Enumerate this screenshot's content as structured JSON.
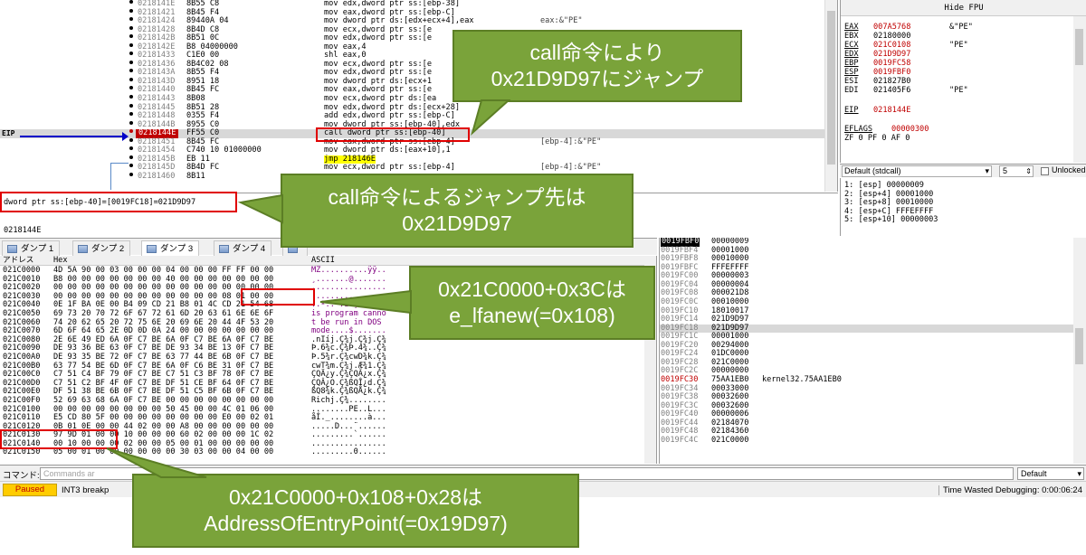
{
  "disasm": {
    "eip_label": "EIP",
    "rows": [
      {
        "addr": "0218141E",
        "bytes": "8B55 C8",
        "instr": "mov edx,dword ptr ss:[ebp-38]",
        "comment": ""
      },
      {
        "addr": "02181421",
        "bytes": "8B45 F4",
        "instr": "mov eax,dword ptr ss:[ebp-C]",
        "comment": ""
      },
      {
        "addr": "02181424",
        "bytes": "89440A 04",
        "instr": "mov dword ptr ds:[edx+ecx+4],eax",
        "comment": "eax:&\"PE\""
      },
      {
        "addr": "02181428",
        "bytes": "8B4D C8",
        "instr": "mov ecx,dword ptr ss:[e",
        "comment": ""
      },
      {
        "addr": "0218142B",
        "bytes": "8B51 0C",
        "instr": "mov edx,dword ptr ss:[e",
        "comment": ""
      },
      {
        "addr": "0218142E",
        "bytes": "B8 04000000",
        "instr": "mov eax,4",
        "comment": ""
      },
      {
        "addr": "02181433",
        "bytes": "C1E0 00",
        "instr": "shl eax,0",
        "comment": ""
      },
      {
        "addr": "02181436",
        "bytes": "8B4C02 08",
        "instr": "mov ecx,dword ptr ss:[e",
        "comment": ""
      },
      {
        "addr": "0218143A",
        "bytes": "8B55 F4",
        "instr": "mov edx,dword ptr ss:[e",
        "comment": ""
      },
      {
        "addr": "0218143D",
        "bytes": "8951 18",
        "instr": "mov dword ptr ds:[ecx+1",
        "comment": ""
      },
      {
        "addr": "02181440",
        "bytes": "8B45 FC",
        "instr": "mov eax,dword ptr ss:[e",
        "comment": ""
      },
      {
        "addr": "02181443",
        "bytes": "8B08",
        "instr": "mov ecx,dword ptr ds:[ea",
        "comment": ""
      },
      {
        "addr": "02181445",
        "bytes": "8B51 28",
        "instr": "mov edx,dword ptr ds:[ecx+28]",
        "comment": ""
      },
      {
        "addr": "02181448",
        "bytes": "0355 F4",
        "instr": "add edx,dword ptr ss:[ebp-C]",
        "comment": ""
      },
      {
        "addr": "0218144B",
        "bytes": "8955 C0",
        "instr": "mov dword ptr ss:[ebp-40],edx",
        "comment": ""
      },
      {
        "addr": "0218144E",
        "bytes": "FF55 C0",
        "instr": "call dword ptr ss:[ebp-40]",
        "comment": ""
      },
      {
        "addr": "02181451",
        "bytes": "8B45 FC",
        "instr": "mov eax,dword ptr ss:[ebp-4]",
        "comment": "[ebp-4]:&\"PE\""
      },
      {
        "addr": "02181454",
        "bytes": "C740 10 01000000",
        "instr": "mov dword ptr ds:[eax+10],1",
        "comment": ""
      },
      {
        "addr": "0218145B",
        "bytes": "EB 11",
        "instr": "jmp 218146E",
        "comment": ""
      },
      {
        "addr": "0218145D",
        "bytes": "8B4D FC",
        "instr": "mov ecx,dword ptr ss:[ebp-4]",
        "comment": "[ebp-4]:&\"PE\""
      },
      {
        "addr": "02181460",
        "bytes": "8B11",
        "instr": "",
        "comment": ""
      }
    ]
  },
  "info": {
    "line": "dword ptr ss:[ebp-40]=[0019FC18]=021D9D97",
    "addr": "0218144E"
  },
  "registers": {
    "header": "Hide FPU",
    "rows": [
      {
        "name": "EAX",
        "value": "007A5768",
        "comment": "&\"PE\"",
        "changed": true
      },
      {
        "name": "EBX",
        "value": "02180000",
        "comment": "",
        "changed": false
      },
      {
        "name": "ECX",
        "value": "021C0108",
        "comment": "\"PE\"",
        "changed": true
      },
      {
        "name": "EDX",
        "value": "021D9D97",
        "comment": "",
        "changed": true
      },
      {
        "name": "EBP",
        "value": "0019FC58",
        "comment": "",
        "changed": true
      },
      {
        "name": "ESP",
        "value": "0019FBF0",
        "comment": "",
        "changed": true
      },
      {
        "name": "ESI",
        "value": "021827B0",
        "comment": "",
        "changed": false
      },
      {
        "name": "EDI",
        "value": "021405F6",
        "comment": "\"PE\"",
        "changed": false
      },
      {
        "name": "EIP",
        "value": "0218144E",
        "comment": "",
        "changed": true
      },
      {
        "name": "EFLAGS",
        "value": "00000300",
        "comment": "",
        "changed": true
      }
    ],
    "flags": "ZF 0  PF 0  AF 0"
  },
  "callstack": {
    "convention": "Default (stdcall)",
    "arg_count": "5",
    "unlocked_label": "Unlocked",
    "args": [
      "1: [esp] 00000009",
      "2: [esp+4] 00001000",
      "3: [esp+8] 00010000",
      "4: [esp+C] FFFEFFFF",
      "5: [esp+10] 00000003"
    ]
  },
  "dump_tabs": [
    "ダンプ 1",
    "ダンプ 2",
    "ダンプ 3",
    "ダンプ 4",
    ""
  ],
  "dump": {
    "col_addr": "アドレス",
    "col_hex": "Hex",
    "col_ascii": "ASCII",
    "rows": [
      {
        "addr": "021C0000",
        "hex": "4D 5A 90 00 03 00 00 00 04 00 00 00 FF FF 00 00",
        "ascii": "MZ..........ÿÿ.."
      },
      {
        "addr": "021C0010",
        "hex": "B8 00 00 00 00 00 00 00 40 00 00 00 00 00 00 00",
        "ascii": "¸.......@......."
      },
      {
        "addr": "021C0020",
        "hex": "00 00 00 00 00 00 00 00 00 00 00 00 00 00 00 00",
        "ascii": "................"
      },
      {
        "addr": "021C0030",
        "hex": "00 00 00 00 00 00 00 00 00 00 00 00 08 01 00 00",
        "ascii": "................"
      },
      {
        "addr": "021C0040",
        "hex": "0E 1F BA 0E 00 B4 09 CD 21 B8 01 4C CD 21 54 68",
        "ascii": "..º..´.Í!¸.LÍ!Th"
      },
      {
        "addr": "021C0050",
        "hex": "69 73 20 70 72 6F 67 72 61 6D 20 63 61 6E 6E 6F",
        "ascii": "is program canno"
      },
      {
        "addr": "021C0060",
        "hex": "74 20 62 65 20 72 75 6E 20 69 6E 20 44 4F 53 20",
        "ascii": "t be run in DOS "
      },
      {
        "addr": "021C0070",
        "hex": "6D 6F 64 65 2E 0D 0D 0A 24 00 00 00 00 00 00 00",
        "ascii": "mode....$......."
      },
      {
        "addr": "021C0080",
        "hex": "2E 6E 49 ED 6A 0F C7 BE 6A 0F C7 BE 6A 0F C7 BE",
        "ascii": ".nIíj.Ç¾j.Ç¾j.Ç¾"
      },
      {
        "addr": "021C0090",
        "hex": "DE 93 36 BE 63 0F C7 BE DE 93 34 BE 13 0F C7 BE",
        "ascii": "Þ.6¾c.Ç¾Þ.4¾..Ç¾"
      },
      {
        "addr": "021C00A0",
        "hex": "DE 93 35 BE 72 0F C7 BE 63 77 44 BE 6B 0F C7 BE",
        "ascii": "Þ.5¾r.Ç¾cwD¾k.Ç¾"
      },
      {
        "addr": "021C00B0",
        "hex": "63 77 54 BE 6D 0F C7 BE 6A 0F C6 BE 31 0F C7 BE",
        "ascii": "cwT¾m.Ç¾j.Æ¾1.Ç¾"
      },
      {
        "addr": "021C00C0",
        "hex": "C7 51 C4 BF 79 0F C7 BE C7 51 C3 BF 78 0F C7 BE",
        "ascii": "ÇQÄ¿y.Ç¾ÇQÃ¿x.Ç¾"
      },
      {
        "addr": "021C00D0",
        "hex": "C7 51 C2 BF 4F 0F C7 BE DF 51 CE BF 64 0F C7 BE",
        "ascii": "ÇQÂ¿O.Ç¾ßQÎ¿d.Ç¾"
      },
      {
        "addr": "021C00E0",
        "hex": "DF 51 38 BE 6B 0F C7 BE DF 51 C5 BF 6B 0F C7 BE",
        "ascii": "ßQ8¾k.Ç¾ßQÅ¿k.Ç¾"
      },
      {
        "addr": "021C00F0",
        "hex": "52 69 63 68 6A 0F C7 BE 00 00 00 00 00 00 00 00",
        "ascii": "Richj.Ç¾........"
      },
      {
        "addr": "021C0100",
        "hex": "00 00 00 00 00 00 00 00 50 45 00 00 4C 01 06 00",
        "ascii": "........PE..L..."
      },
      {
        "addr": "021C0110",
        "hex": "E5 CD 80 5F 00 00 00 00 00 00 00 00 E0 00 02 01",
        "ascii": "åÍ._........à..."
      },
      {
        "addr": "021C0120",
        "hex": "0B 01 0E 00 00 44 02 00 00 A8 00 00 00 00 00 00",
        "ascii": ".....D...¨......"
      },
      {
        "addr": "021C0130",
        "hex": "97 9D 01 00 00 10 00 00 00 60 02 00 00 00 1C 02",
        "ascii": ".........`......"
      },
      {
        "addr": "021C0140",
        "hex": "00 10 00 00 00 02 00 00 05 00 01 00 00 00 00 00",
        "ascii": "................"
      },
      {
        "addr": "021C0150",
        "hex": "05 00 01 00 00 00 00 00 00 30 03 00 00 04 00 00",
        "ascii": ".........0......"
      }
    ]
  },
  "stack": {
    "rows": [
      {
        "addr": "0019FBF0",
        "val": "00000009",
        "comment": ""
      },
      {
        "addr": "0019FBF4",
        "val": "00001000",
        "comment": ""
      },
      {
        "addr": "0019FBF8",
        "val": "00010000",
        "comment": ""
      },
      {
        "addr": "0019FBFC",
        "val": "FFFEFFFF",
        "comment": ""
      },
      {
        "addr": "0019FC00",
        "val": "00000003",
        "comment": ""
      },
      {
        "addr": "0019FC04",
        "val": "00000004",
        "comment": ""
      },
      {
        "addr": "0019FC08",
        "val": "000021D8",
        "comment": ""
      },
      {
        "addr": "0019FC0C",
        "val": "00010000",
        "comment": ""
      },
      {
        "addr": "0019FC10",
        "val": "18010017",
        "comment": ""
      },
      {
        "addr": "0019FC14",
        "val": "021D9D97",
        "comment": ""
      },
      {
        "addr": "0019FC18",
        "val": "021D9D97",
        "comment": ""
      },
      {
        "addr": "0019FC1C",
        "val": "00001000",
        "comment": ""
      },
      {
        "addr": "0019FC20",
        "val": "00294000",
        "comment": ""
      },
      {
        "addr": "0019FC24",
        "val": "01DC0000",
        "comment": ""
      },
      {
        "addr": "0019FC28",
        "val": "021C0000",
        "comment": ""
      },
      {
        "addr": "0019FC2C",
        "val": "00000000",
        "comment": ""
      },
      {
        "addr": "0019FC30",
        "val": "75AA1EB0",
        "comment": "kernel32.75AA1EB0"
      },
      {
        "addr": "0019FC34",
        "val": "00033000",
        "comment": ""
      },
      {
        "addr": "0019FC38",
        "val": "00032600",
        "comment": ""
      },
      {
        "addr": "0019FC3C",
        "val": "00032600",
        "comment": ""
      },
      {
        "addr": "0019FC40",
        "val": "00000006",
        "comment": ""
      },
      {
        "addr": "0019FC44",
        "val": "02184070",
        "comment": ""
      },
      {
        "addr": "0019FC48",
        "val": "02184360",
        "comment": ""
      },
      {
        "addr": "0019FC4C",
        "val": "021C0000",
        "comment": ""
      }
    ]
  },
  "command": {
    "label": "コマンド:",
    "placeholder": "Commands ar",
    "default": "Default"
  },
  "status": {
    "paused": "Paused",
    "message": "INT3 breakp",
    "time": "Time Wasted Debugging: 0:00:06:24"
  },
  "callouts": {
    "c1": [
      "call命令により",
      "0x21D9D97にジャンプ"
    ],
    "c2": [
      "call命令によるジャンプ先は",
      "0x21D9D97"
    ],
    "c3": [
      "0x21C0000+0x3Cは",
      "e_lfanew(=0x108)"
    ],
    "c4": [
      "0x21C0000+0x108+0x28は",
      "AddressOfEntryPoint(=0x19D97)"
    ]
  },
  "colors": {
    "callout_fill": "#7aa33a",
    "highlight": "#e00000",
    "changed_value": "#c00000"
  }
}
